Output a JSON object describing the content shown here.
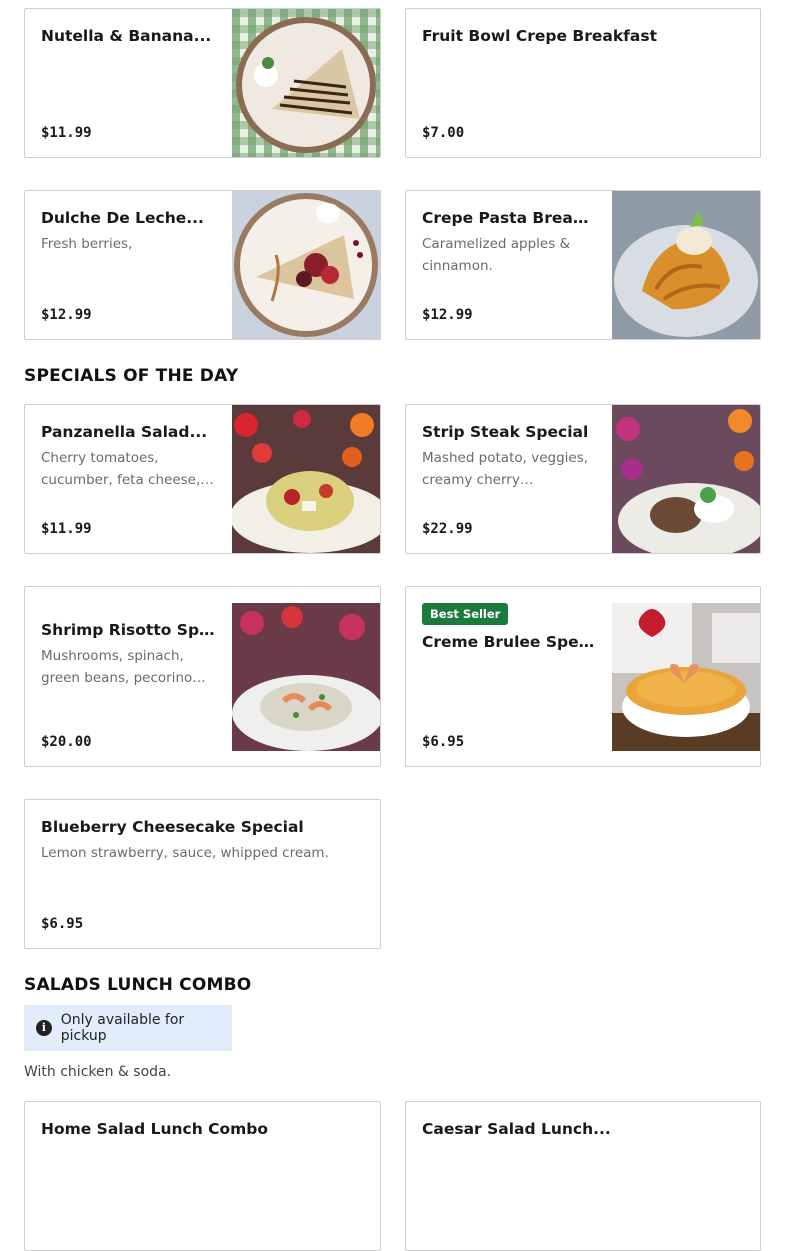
{
  "items": {
    "nutella": {
      "name": "Nutella & Banana...",
      "desc": "",
      "price": "$11.99"
    },
    "fruit_bowl": {
      "name": "Fruit Bowl Crepe Breakfast",
      "desc": "",
      "price": "$7.00"
    },
    "dulche": {
      "name": "Dulche De Leche...",
      "desc": "Fresh berries,",
      "price": "$12.99"
    },
    "crepe_pasta": {
      "name": "Crepe Pasta Breakfast",
      "desc": "Caramelized apples & cinnamon.",
      "price": "$12.99"
    },
    "panzanella": {
      "name": "Panzanella Salad...",
      "desc": "Cherry tomatoes, cucumber, feta cheese, red onion, croutons.",
      "price": "$11.99"
    },
    "strip_steak": {
      "name": "Strip Steak Special",
      "desc": "Mashed potato, veggies, creamy cherry mushroom sauce.",
      "price": "$22.99"
    },
    "shrimp_risotto": {
      "name": "Shrimp Risotto Special",
      "desc": "Mushrooms, spinach, green beans, pecorino cheese.",
      "price": "$20.00"
    },
    "creme_brulee": {
      "name": "Creme Brulee Special",
      "badge": "Best Seller",
      "desc": "",
      "price": "$6.95"
    },
    "blueberry": {
      "name": "Blueberry Cheesecake Special",
      "desc": "Lemon strawberry, sauce, whipped cream.",
      "price": "$6.95"
    },
    "house_salad": {
      "name": "Home Salad Lunch Combo",
      "desc": "",
      "price": ""
    },
    "caesar_salad": {
      "name": "Caesar Salad Lunch...",
      "desc": "",
      "price": ""
    }
  },
  "sections": {
    "specials_title": "SPECIALS OF THE DAY",
    "salads_title": "SALADS LUNCH COMBO",
    "pickup_notice": "Only available for pickup",
    "pickup_icon": "info-icon",
    "salads_note": "With chicken & soda."
  },
  "colors": {
    "badge_green": "#1c7a3c",
    "notice_bg": "#e2edfb"
  }
}
